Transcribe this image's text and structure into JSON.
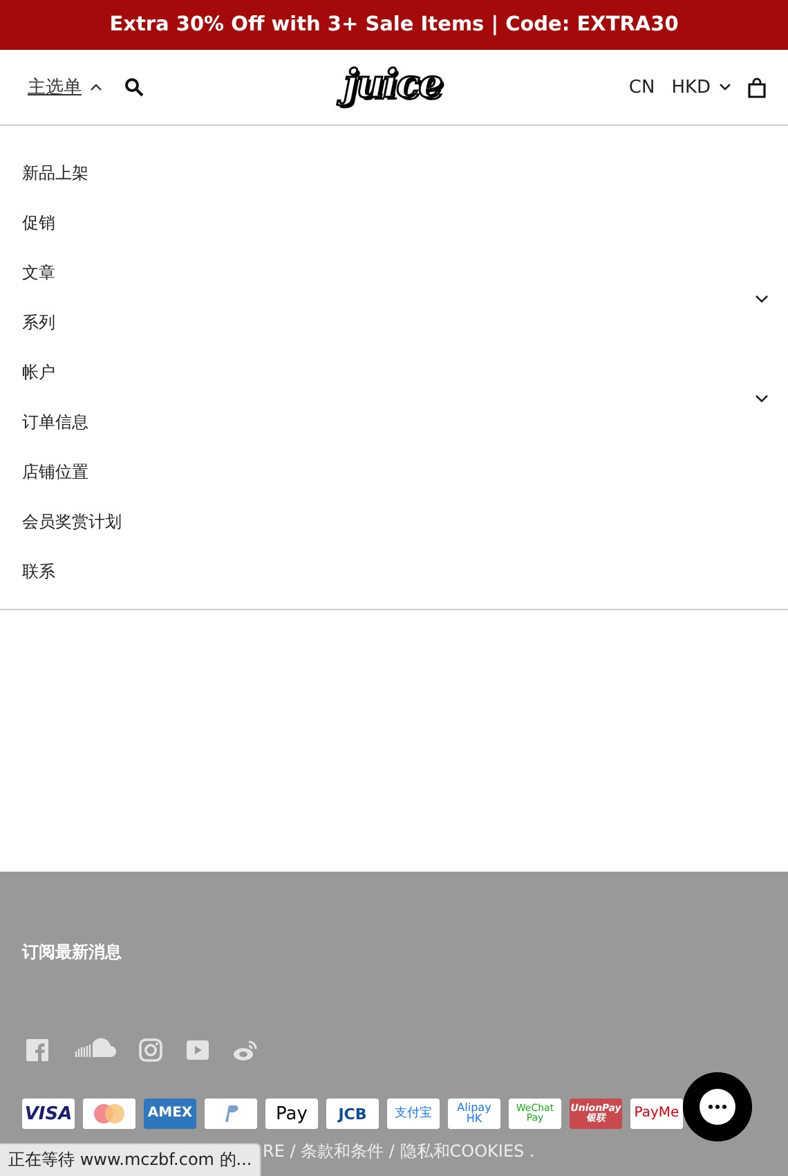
{
  "announcement": "Extra 30% Off with 3+ Sale Items | Code: EXTRA30",
  "header": {
    "menu_toggle": {
      "label": "主选单",
      "expanded": true
    },
    "logo": "juice",
    "language": "CN",
    "currency": "HKD"
  },
  "menu": [
    {
      "label": "新品上架",
      "kind": "link"
    },
    {
      "label": "促销",
      "kind": "link"
    },
    {
      "label": "文章",
      "kind": "link"
    },
    {
      "label": "系列",
      "kind": "group",
      "expanded": false
    },
    {
      "label": "帐户",
      "kind": "link"
    },
    {
      "label": "订单信息",
      "kind": "group",
      "expanded": false
    },
    {
      "label": "店铺位置",
      "kind": "link"
    },
    {
      "label": "会员奖赏计划",
      "kind": "link"
    },
    {
      "label": "联系",
      "kind": "link"
    }
  ],
  "footer": {
    "heading": "订阅最新消息",
    "social": [
      {
        "kind": "facebook"
      },
      {
        "kind": "cloud"
      },
      {
        "kind": "camera"
      },
      {
        "kind": "play"
      },
      {
        "kind": "weibo"
      }
    ],
    "payments": [
      {
        "kind": "visa",
        "label": "VISA"
      },
      {
        "kind": "mastercard"
      },
      {
        "kind": "amex",
        "label": "AMEX"
      },
      {
        "kind": "paypal"
      },
      {
        "kind": "applepay",
        "label": "Pay"
      },
      {
        "kind": "jcb",
        "label": "JCB"
      },
      {
        "kind": "alipay",
        "label": "支付宝"
      },
      {
        "kind": "alipayhk",
        "label": "Alipay HK"
      },
      {
        "kind": "wechat",
        "label": "WeChat Pay"
      },
      {
        "kind": "unionpay",
        "label": "UnionPay 银联"
      },
      {
        "kind": "payme",
        "label": "PayMe"
      }
    ],
    "links_line": "RE / 条款和条件 / 隐私和COOKIES ."
  },
  "status_bar": "正在等待 www.mczbf.com 的..."
}
